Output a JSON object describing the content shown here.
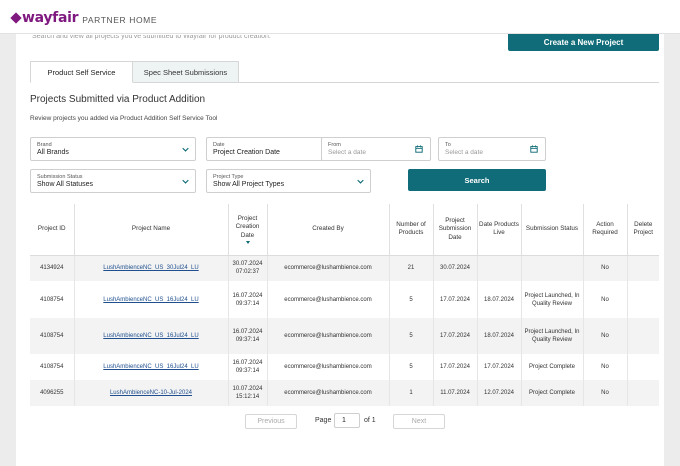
{
  "brand": {
    "name": "wayfair",
    "subtitle": "PARTNER HOME"
  },
  "intro_text": "Search and view all projects you've submitted to Wayfair for product creation.",
  "create_button": "Create a New Project",
  "tabs": [
    {
      "label": "Product Self Service",
      "active": true
    },
    {
      "label": "Spec Sheet Submissions",
      "active": false
    }
  ],
  "section": {
    "title": "Projects Submitted via Product Addition",
    "subtitle": "Review projects you added via Product Addition Self Service Tool"
  },
  "filters": {
    "brand": {
      "label": "Brand",
      "value": "All Brands"
    },
    "date": {
      "label": "Date",
      "value": "Project Creation Date"
    },
    "from": {
      "label": "From",
      "placeholder": "Select a date"
    },
    "to": {
      "label": "To",
      "placeholder": "Select a date"
    },
    "status": {
      "label": "Submission Status",
      "value": "Show All Statuses"
    },
    "type": {
      "label": "Project Type",
      "value": "Show All Project Types"
    }
  },
  "search_button": "Search",
  "table": {
    "headers": [
      "Project ID",
      "Project Name",
      "Project Creation Date",
      "Created By",
      "Number of Products",
      "Project Submission Date",
      "Date Products Live",
      "Submission Status",
      "Action Required",
      "Delete Project"
    ],
    "rows": [
      {
        "id": "4134924",
        "name": "LushAmbienceNC_US_30Jul24_LU",
        "created_date": "30.07.2024",
        "created_time": "07:02:37",
        "created_by": "ecommerce@lushambience.com",
        "products": "21",
        "submitted": "30.07.2024",
        "live": "",
        "status": "",
        "action": "No",
        "delete": ""
      },
      {
        "id": "4108754",
        "name": "LushAmbienceNC_US_16Jul24_LU",
        "created_date": "16.07.2024",
        "created_time": "09:37:14",
        "created_by": "ecommerce@lushambience.com",
        "products": "5",
        "submitted": "17.07.2024",
        "live": "18.07.2024",
        "status": "Project Launched, In Quality Review",
        "action": "No",
        "delete": ""
      },
      {
        "id": "4108754",
        "name": "LushAmbienceNC_US_16Jul24_LU",
        "created_date": "16.07.2024",
        "created_time": "09:37:14",
        "created_by": "ecommerce@lushambience.com",
        "products": "5",
        "submitted": "17.07.2024",
        "live": "18.07.2024",
        "status": "Project Launched, In Quality Review",
        "action": "No",
        "delete": ""
      },
      {
        "id": "4108754",
        "name": "LushAmbienceNC_US_16Jul24_LU",
        "created_date": "16.07.2024",
        "created_time": "09:37:14",
        "created_by": "ecommerce@lushambience.com",
        "products": "5",
        "submitted": "17.07.2024",
        "live": "17.07.2024",
        "status": "Project Complete",
        "action": "No",
        "delete": ""
      },
      {
        "id": "4096255",
        "name": "LushAmbienceNC-10-Jul-2024",
        "created_date": "10.07.2024",
        "created_time": "15:12:14",
        "created_by": "ecommerce@lushambience.com",
        "products": "1",
        "submitted": "11.07.2024",
        "live": "12.07.2024",
        "status": "Project Complete",
        "action": "No",
        "delete": ""
      }
    ]
  },
  "pagination": {
    "previous": "Previous",
    "page_label": "Page",
    "page_value": "1",
    "of_label": "of 1",
    "next": "Next"
  },
  "colors": {
    "brand": "#7f187f",
    "accent": "#0f6c78",
    "link": "#1f4f8f"
  }
}
